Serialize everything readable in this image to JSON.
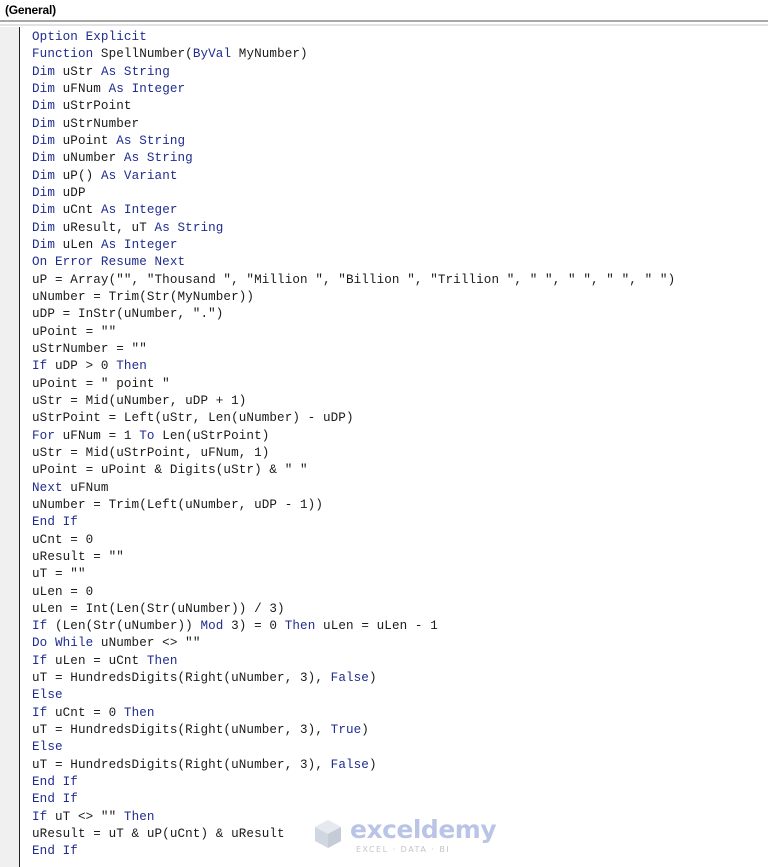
{
  "window": {
    "procedure_dropdown": "(General)"
  },
  "code": {
    "lines": [
      [
        {
          "t": "Option Explicit",
          "k": true
        }
      ],
      [
        {
          "t": "Function",
          "k": true
        },
        {
          "t": " SpellNumber("
        },
        {
          "t": "ByVal",
          "k": true
        },
        {
          "t": " MyNumber)"
        }
      ],
      [
        {
          "t": "Dim",
          "k": true
        },
        {
          "t": " uStr "
        },
        {
          "t": "As String",
          "k": true
        }
      ],
      [
        {
          "t": "Dim",
          "k": true
        },
        {
          "t": " uFNum "
        },
        {
          "t": "As Integer",
          "k": true
        }
      ],
      [
        {
          "t": "Dim",
          "k": true
        },
        {
          "t": " uStrPoint"
        }
      ],
      [
        {
          "t": "Dim",
          "k": true
        },
        {
          "t": " uStrNumber"
        }
      ],
      [
        {
          "t": "Dim",
          "k": true
        },
        {
          "t": " uPoint "
        },
        {
          "t": "As String",
          "k": true
        }
      ],
      [
        {
          "t": "Dim",
          "k": true
        },
        {
          "t": " uNumber "
        },
        {
          "t": "As String",
          "k": true
        }
      ],
      [
        {
          "t": "Dim",
          "k": true
        },
        {
          "t": " uP() "
        },
        {
          "t": "As Variant",
          "k": true
        }
      ],
      [
        {
          "t": "Dim",
          "k": true
        },
        {
          "t": " uDP"
        }
      ],
      [
        {
          "t": "Dim",
          "k": true
        },
        {
          "t": " uCnt "
        },
        {
          "t": "As Integer",
          "k": true
        }
      ],
      [
        {
          "t": "Dim",
          "k": true
        },
        {
          "t": " uResult, uT "
        },
        {
          "t": "As String",
          "k": true
        }
      ],
      [
        {
          "t": "Dim",
          "k": true
        },
        {
          "t": " uLen "
        },
        {
          "t": "As Integer",
          "k": true
        }
      ],
      [
        {
          "t": "On Error Resume Next",
          "k": true
        }
      ],
      [
        {
          "t": "uP = Array(\"\", \"Thousand \", \"Million \", \"Billion \", \"Trillion \", \" \", \" \", \" \", \" \")"
        }
      ],
      [
        {
          "t": "uNumber = Trim(Str(MyNumber))"
        }
      ],
      [
        {
          "t": "uDP = InStr(uNumber, \".\")"
        }
      ],
      [
        {
          "t": "uPoint = \"\""
        }
      ],
      [
        {
          "t": "uStrNumber = \"\""
        }
      ],
      [
        {
          "t": "If",
          "k": true
        },
        {
          "t": " uDP > 0 "
        },
        {
          "t": "Then",
          "k": true
        }
      ],
      [
        {
          "t": "uPoint = \" point \""
        }
      ],
      [
        {
          "t": "uStr = Mid(uNumber, uDP + 1)"
        }
      ],
      [
        {
          "t": "uStrPoint = Left(uStr, Len(uNumber) - uDP)"
        }
      ],
      [
        {
          "t": "For",
          "k": true
        },
        {
          "t": " uFNum = 1 "
        },
        {
          "t": "To",
          "k": true
        },
        {
          "t": " Len(uStrPoint)"
        }
      ],
      [
        {
          "t": "uStr = Mid(uStrPoint, uFNum, 1)"
        }
      ],
      [
        {
          "t": "uPoint = uPoint & Digits(uStr) & \" \""
        }
      ],
      [
        {
          "t": "Next",
          "k": true
        },
        {
          "t": " uFNum"
        }
      ],
      [
        {
          "t": "uNumber = Trim(Left(uNumber, uDP - 1))"
        }
      ],
      [
        {
          "t": "End If",
          "k": true
        }
      ],
      [
        {
          "t": "uCnt = 0"
        }
      ],
      [
        {
          "t": "uResult = \"\""
        }
      ],
      [
        {
          "t": "uT = \"\""
        }
      ],
      [
        {
          "t": "uLen = 0"
        }
      ],
      [
        {
          "t": "uLen = Int(Len(Str(uNumber)) / 3)"
        }
      ],
      [
        {
          "t": "If",
          "k": true
        },
        {
          "t": " (Len(Str(uNumber)) "
        },
        {
          "t": "Mod",
          "k": true
        },
        {
          "t": " 3) = 0 "
        },
        {
          "t": "Then",
          "k": true
        },
        {
          "t": " uLen = uLen - 1"
        }
      ],
      [
        {
          "t": "Do While",
          "k": true
        },
        {
          "t": " uNumber <> \"\""
        }
      ],
      [
        {
          "t": "If",
          "k": true
        },
        {
          "t": " uLen = uCnt "
        },
        {
          "t": "Then",
          "k": true
        }
      ],
      [
        {
          "t": "uT = HundredsDigits(Right(uNumber, 3), "
        },
        {
          "t": "False",
          "k": true
        },
        {
          "t": ")"
        }
      ],
      [
        {
          "t": "Else",
          "k": true
        }
      ],
      [
        {
          "t": "If",
          "k": true
        },
        {
          "t": " uCnt = 0 "
        },
        {
          "t": "Then",
          "k": true
        }
      ],
      [
        {
          "t": "uT = HundredsDigits(Right(uNumber, 3), "
        },
        {
          "t": "True",
          "k": true
        },
        {
          "t": ")"
        }
      ],
      [
        {
          "t": "Else",
          "k": true
        }
      ],
      [
        {
          "t": "uT = HundredsDigits(Right(uNumber, 3), "
        },
        {
          "t": "False",
          "k": true
        },
        {
          "t": ")"
        }
      ],
      [
        {
          "t": "End If",
          "k": true
        }
      ],
      [
        {
          "t": "End If",
          "k": true
        }
      ],
      [
        {
          "t": "If",
          "k": true
        },
        {
          "t": " uT <> \"\" "
        },
        {
          "t": "Then",
          "k": true
        }
      ],
      [
        {
          "t": "uResult = uT & uP(uCnt) & uResult"
        }
      ],
      [
        {
          "t": "End If",
          "k": true
        }
      ]
    ]
  },
  "watermark": {
    "brand": "exceldemy",
    "tagline": "EXCEL · DATA · BI"
  },
  "colors": {
    "keyword": "#1f2c8f",
    "text": "#1a1a1a"
  }
}
